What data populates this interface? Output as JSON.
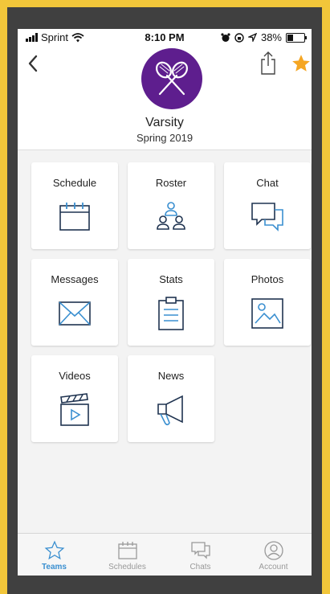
{
  "status_bar": {
    "carrier": "Sprint",
    "time": "8:10 PM",
    "battery": "38%",
    "battery_level": 0.38
  },
  "header": {
    "team_name": "Varsity",
    "season": "Spring 2019"
  },
  "tiles": [
    {
      "label": "Schedule",
      "icon": "calendar-icon"
    },
    {
      "label": "Roster",
      "icon": "people-icon"
    },
    {
      "label": "Chat",
      "icon": "chat-bubbles-icon"
    },
    {
      "label": "Messages",
      "icon": "envelope-icon"
    },
    {
      "label": "Stats",
      "icon": "clipboard-icon"
    },
    {
      "label": "Photos",
      "icon": "image-icon"
    },
    {
      "label": "Videos",
      "icon": "clapperboard-icon"
    },
    {
      "label": "News",
      "icon": "megaphone-icon"
    }
  ],
  "tabbar": {
    "items": [
      {
        "label": "Teams",
        "icon": "star-outline-icon",
        "active": true
      },
      {
        "label": "Schedules",
        "icon": "calendar-icon"
      },
      {
        "label": "Chats",
        "icon": "chat-bubbles-icon"
      },
      {
        "label": "Account",
        "icon": "user-circle-icon"
      }
    ]
  },
  "colors": {
    "accent": "#3a8fd0",
    "team_purple": "#5e1e8e",
    "star": "#f5a623",
    "frame_yellow": "#f2c63a"
  }
}
